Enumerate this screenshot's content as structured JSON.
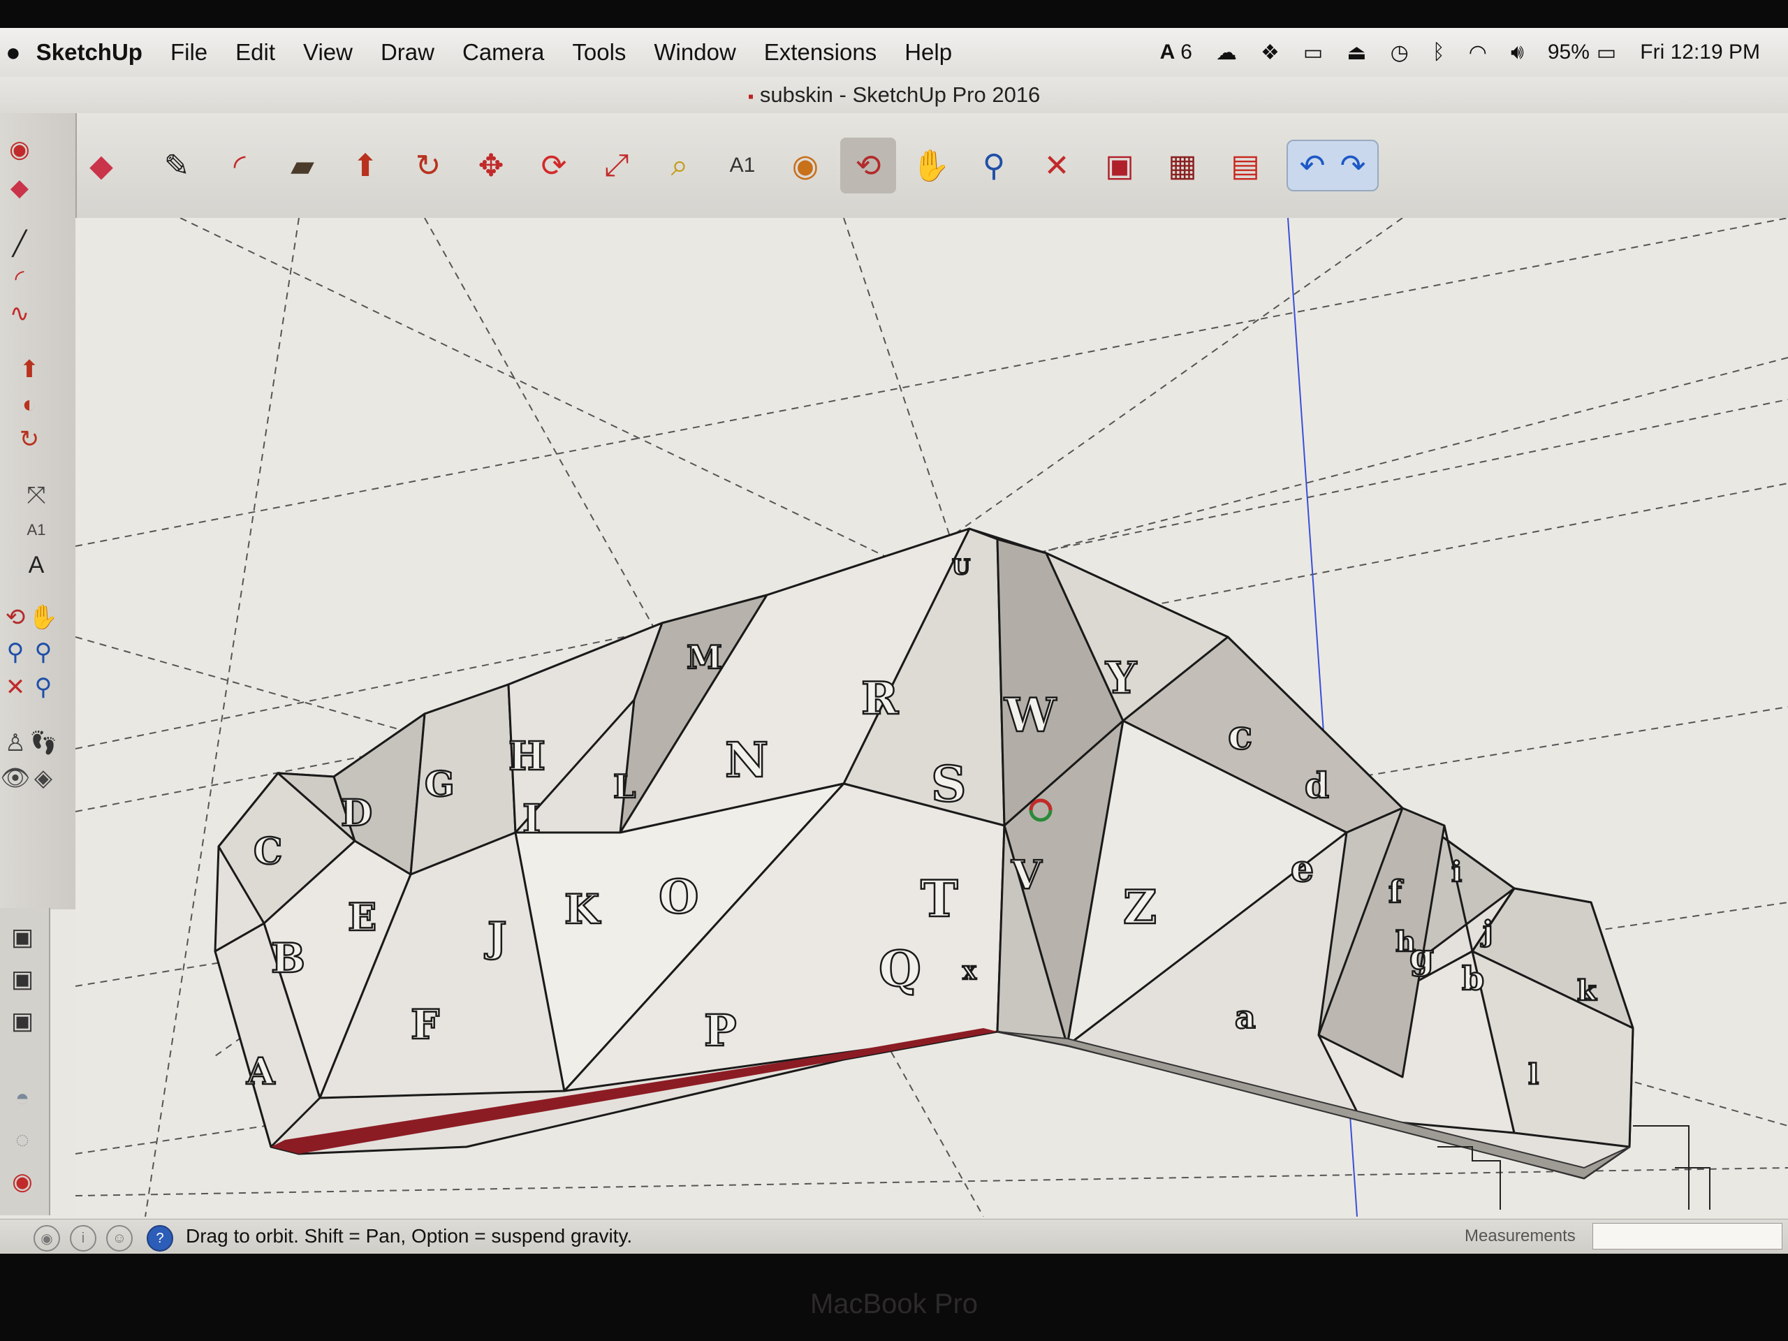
{
  "menubar": {
    "apple": "",
    "app_name": "SketchUp",
    "items": [
      "File",
      "Edit",
      "View",
      "Draw",
      "Camera",
      "Tools",
      "Window",
      "Extensions",
      "Help"
    ],
    "status": {
      "adobe": "6",
      "battery": "95%",
      "clock": "Fri 12:19 PM"
    }
  },
  "window": {
    "title": "subskin - SketchUp Pro 2016"
  },
  "toolbar": {
    "tools": [
      "eraser-icon",
      "pencil-icon",
      "arc-icon",
      "rectangle-icon",
      "push-pull-icon",
      "follow-me-icon",
      "move-icon",
      "rotate-icon",
      "scale-icon",
      "tape-measure-icon",
      "text-icon",
      "paint-bucket-icon",
      "orbit-icon",
      "pan-icon",
      "zoom-icon",
      "zoom-extents-icon",
      "3d-warehouse-icon",
      "extension-warehouse-icon",
      "layout-icon"
    ],
    "active": "orbit-icon",
    "undo_redo": [
      "undo-icon",
      "redo-icon"
    ]
  },
  "model": {
    "letters": [
      "A",
      "B",
      "C",
      "D",
      "E",
      "F",
      "G",
      "H",
      "I",
      "J",
      "K",
      "L",
      "M",
      "N",
      "O",
      "P",
      "Q",
      "R",
      "S",
      "T",
      "U",
      "V",
      "W",
      "X",
      "Y",
      "Z",
      "a",
      "b",
      "c",
      "d",
      "e",
      "f",
      "g",
      "h",
      "i",
      "j",
      "k",
      "l"
    ],
    "accent_edge": "#8c1c24",
    "axis_blue": "#3a4fd8"
  },
  "statusbar": {
    "message": "Drag to orbit. Shift = Pan, Option = suspend gravity.",
    "measurements_label": "Measurements",
    "measurements_value": ""
  },
  "bezel": {
    "label": "MacBook Pro"
  }
}
